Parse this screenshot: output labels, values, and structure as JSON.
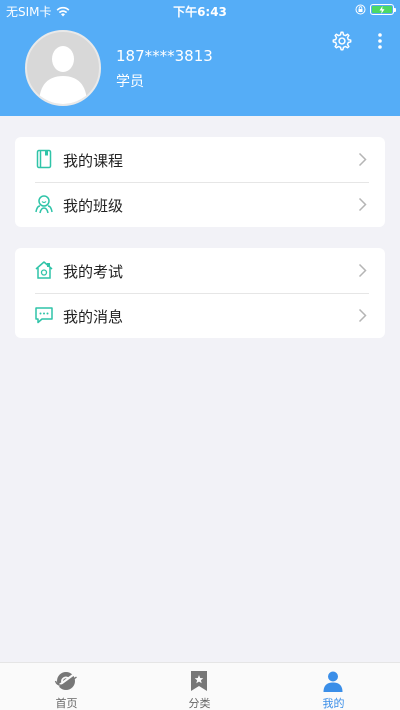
{
  "status": {
    "carrier": "无SIM卡",
    "time": "下午6:43"
  },
  "profile": {
    "phone": "187****3813",
    "role": "学员"
  },
  "menu_group_1": [
    {
      "label": "我的课程",
      "icon": "book-icon"
    },
    {
      "label": "我的班级",
      "icon": "class-group-icon"
    }
  ],
  "menu_group_2": [
    {
      "label": "我的考试",
      "icon": "exam-house-icon"
    },
    {
      "label": "我的消息",
      "icon": "message-icon"
    }
  ],
  "tabs": [
    {
      "label": "首页",
      "icon": "home-planet-icon",
      "active": false
    },
    {
      "label": "分类",
      "icon": "bookmark-star-icon",
      "active": false
    },
    {
      "label": "我的",
      "icon": "person-icon",
      "active": true
    }
  ],
  "colors": {
    "header": "#55adf7",
    "accent_teal": "#2fc4a8",
    "tab_active": "#3a8ee8",
    "tab_inactive": "#666666",
    "background": "#f2f2f7",
    "battery": "#4cd964"
  }
}
